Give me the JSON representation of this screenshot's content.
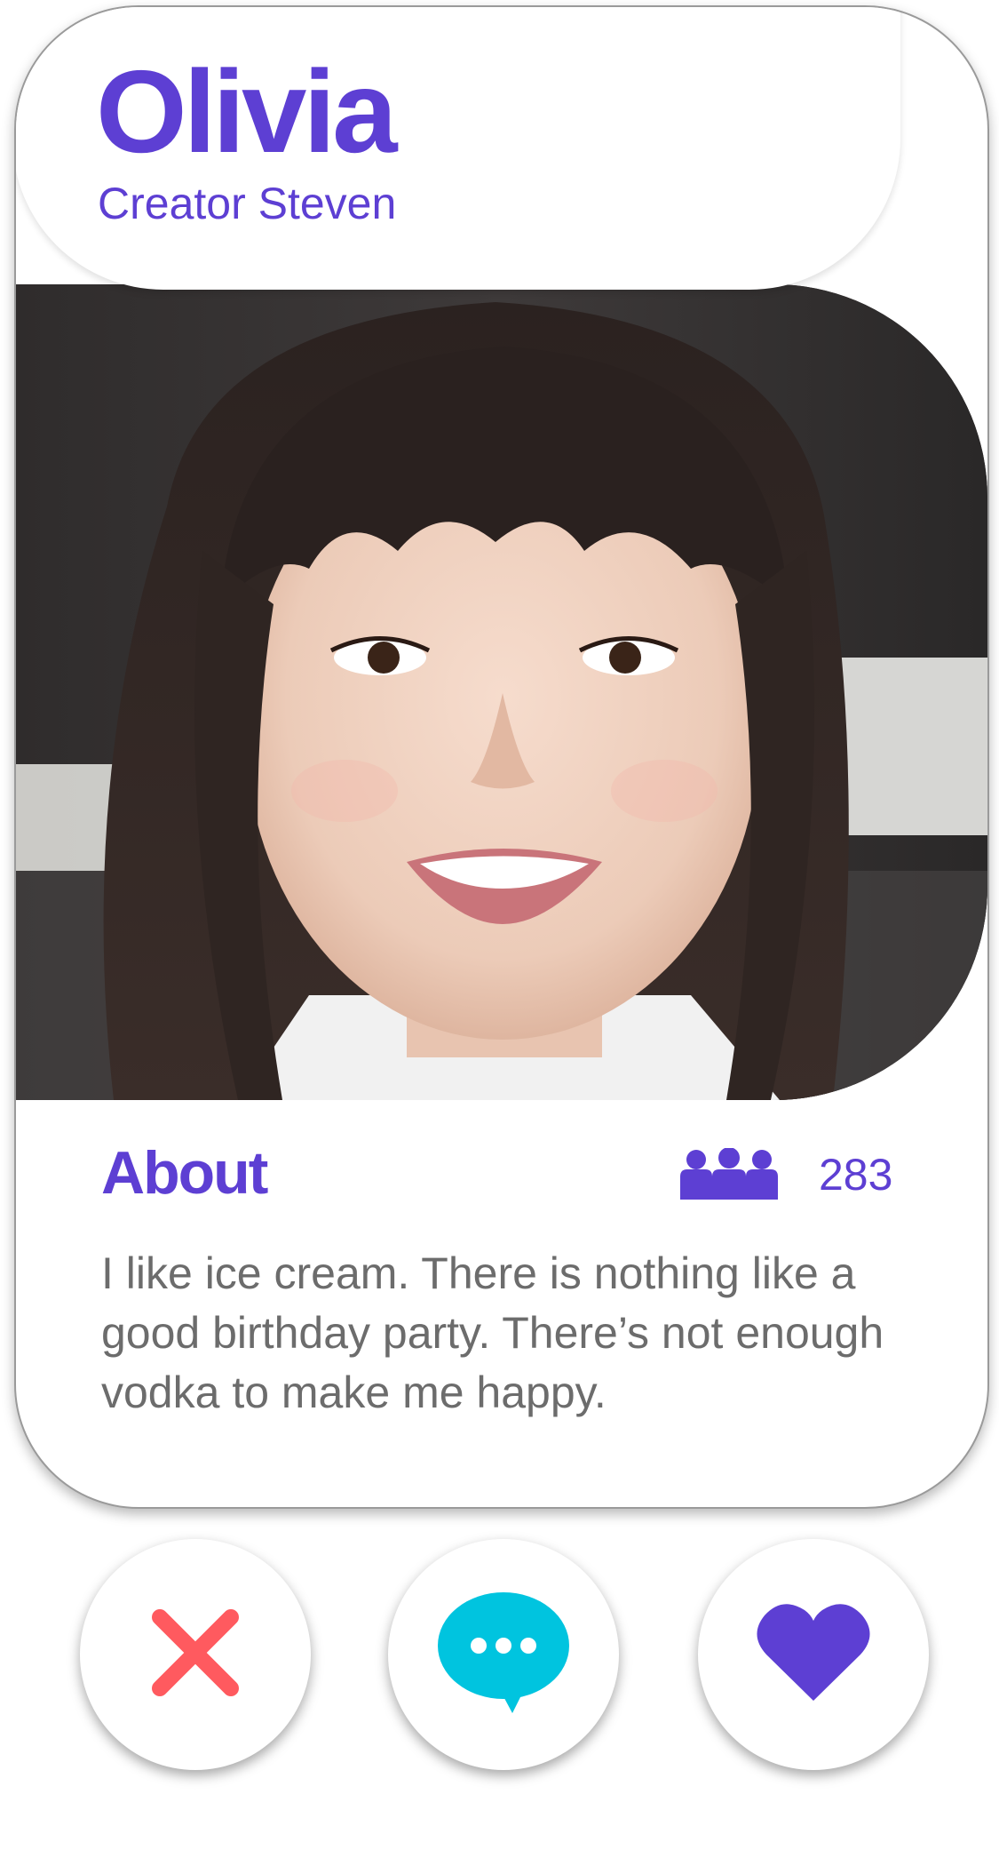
{
  "profile": {
    "name": "Olivia",
    "creator": "Creator Steven"
  },
  "about": {
    "title": "About",
    "followers_count": "283",
    "text": "I like ice cream. There is nothing like a good birthday party. There’s not enough vodka to make me happy."
  },
  "actions": [
    {
      "name": "reject",
      "icon": "close-icon",
      "color": "#ff5a5f"
    },
    {
      "name": "chat",
      "icon": "chat-bubble-icon",
      "color": "#00c4df"
    },
    {
      "name": "like",
      "icon": "heart-icon",
      "color": "#5d3fd3"
    }
  ],
  "colors": {
    "accent": "#5d3fd3",
    "reject": "#ff5a5f",
    "chat": "#00c4df",
    "body_text": "#6c6c6c"
  }
}
